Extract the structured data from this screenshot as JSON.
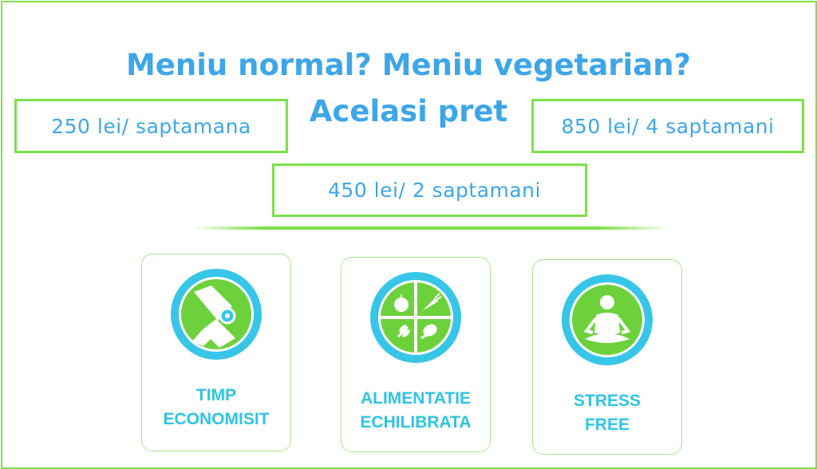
{
  "title": {
    "line1": "Meniu normal? Meniu vegetarian?",
    "line2": "Acelasi pret"
  },
  "prices": {
    "weekly": "250 lei/ saptamana",
    "four_weeks": "850 lei/ 4 saptamani",
    "two_weeks": "450 lei/ 2 saptamani"
  },
  "features": [
    {
      "icon": "watch-hand-icon",
      "line1": "TIMP",
      "line2": "ECONOMISIT"
    },
    {
      "icon": "balanced-plate-icon",
      "line1": "ALIMENTATIE",
      "line2": "ECHILIBRATA"
    },
    {
      "icon": "meditation-icon",
      "line1": "STRESS",
      "line2": "FREE"
    }
  ],
  "colors": {
    "title_blue": "#3ea6e8",
    "label_cyan": "#2ec4e6",
    "accent_green": "#7de04a",
    "ring_cyan": "#38c6e8"
  }
}
